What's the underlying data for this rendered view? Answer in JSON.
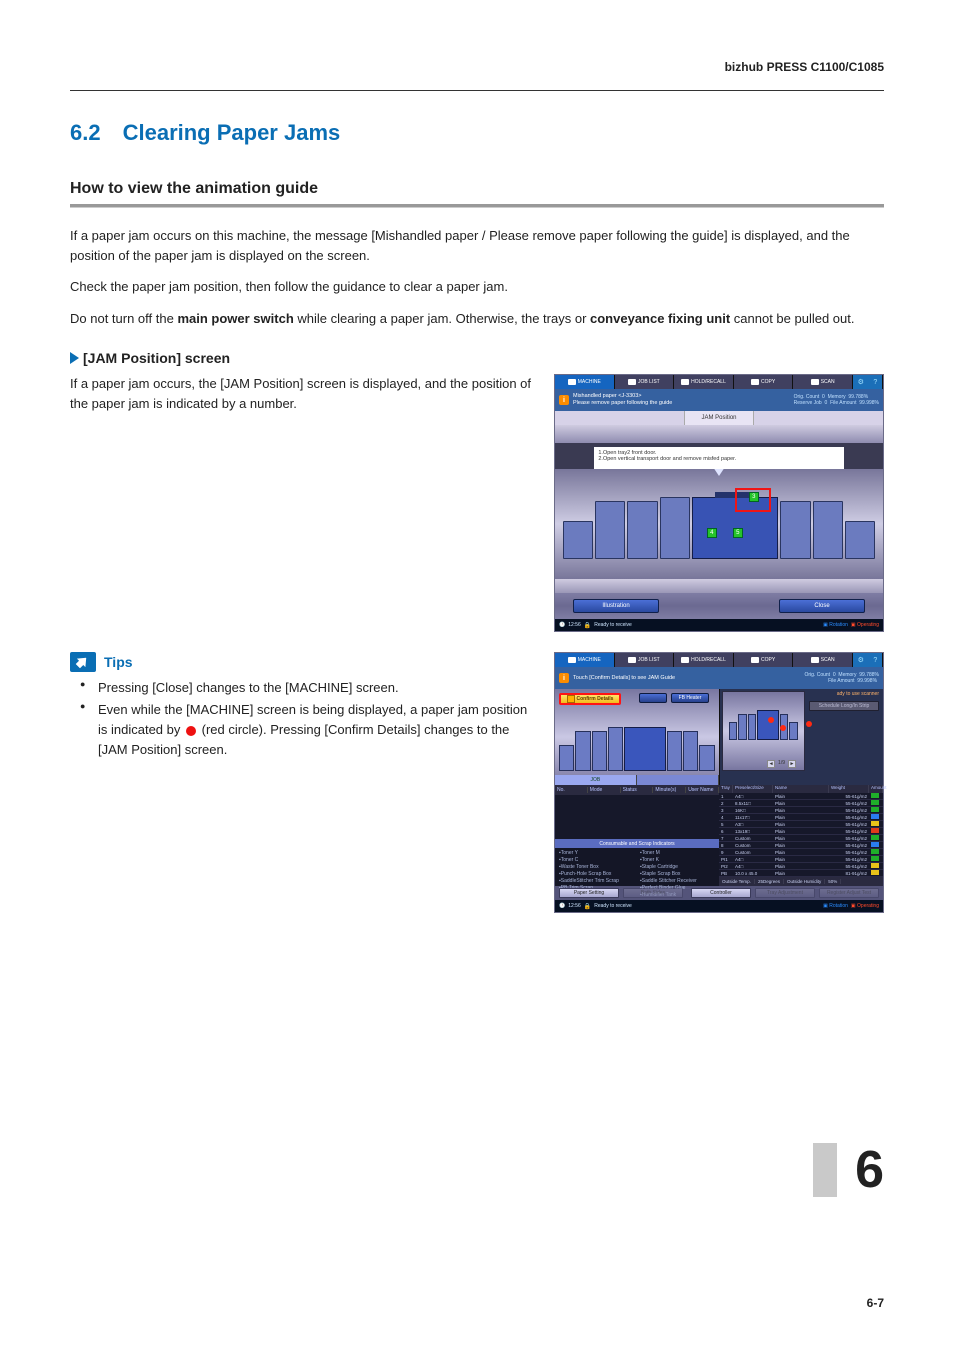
{
  "header": {
    "model": "bizhub PRESS C1100/C1085"
  },
  "section": {
    "number": "6.2",
    "title": "Clearing Paper Jams"
  },
  "subheading1": "How to view the animation guide",
  "intro_paras": {
    "p1": "If a paper jam occurs on this machine, the message [Mishandled paper / Please remove paper following the guide] is displayed, and the position of the paper jam is displayed on the screen.",
    "p2": "Check the paper jam position, then follow the guidance to clear a paper jam.",
    "p3_a": "Do not turn off the ",
    "p3_b": "main power switch",
    "p3_c": " while clearing a paper jam. Otherwise, the trays or ",
    "p3_d": "conveyance fixing unit",
    "p3_e": " cannot be pulled out."
  },
  "h3": "[JAM Position] screen",
  "jam_para": "If a paper jam occurs, the [JAM Position] screen is displayed, and the position of the paper jam is indicated by a number.",
  "tips_label": "Tips",
  "tips": {
    "t1": "Pressing [Close] changes to the [MACHINE] screen.",
    "t2_a": "Even while the [MACHINE] screen is being displayed, a paper jam position is indicated by ",
    "t2_b": " (red circle). Pressing [Confirm Details] changes to the [JAM Position] screen."
  },
  "screenshot1": {
    "tabs": {
      "machine": "MACHINE",
      "joblist": "JOB LIST",
      "recall": "HOLD/RECALL",
      "copy": "COPY",
      "scan": "SCAN"
    },
    "msg": {
      "l1": "Mishandled paper  <J-3303>",
      "l2": "Please remove paper following the guide"
    },
    "counters": {
      "orig": "Orig. Count",
      "orig_v": "0",
      "mem": "Memory",
      "mem_v": "99.788%",
      "res": "Reserve Job",
      "res_v": "0",
      "file": "File Amount",
      "file_v": "99.998%"
    },
    "jam_label": "JAM Position",
    "instructions": {
      "l1": "1.Open tray2 front door.",
      "l2": "2.Open vertical transport door and remove misfed paper."
    },
    "jam_numbers": {
      "a": "3",
      "b": "4",
      "c": "5"
    },
    "buttons": {
      "illust": "Illustration",
      "close": "Close"
    },
    "status": {
      "time": "12:56",
      "ready": "Ready to receive",
      "rot": "Rotation",
      "oper": "Operating"
    }
  },
  "screenshot2": {
    "msg": "Touch [Confirm Details] to see JAM Guide",
    "confirm": "Confirm Details",
    "heater_btn": "FB Heater",
    "ready_scanner": "ady to use scanner",
    "sched_btn": "Schedule Long/In Strip",
    "job_tab": "JOB",
    "job_headers": {
      "no": "No.",
      "mode": "Mode",
      "status": "Status",
      "min": "Minute(s)",
      "user": "User Name"
    },
    "consumable_title": "Consumable and Scrap Indicators",
    "consumables": {
      "left": [
        "Toner Y",
        "Toner C",
        "Waste Toner Box",
        "Punch-Hole Scrap Box",
        "SaddleStitcher Trim Scrap",
        "PB Trim Scrap"
      ],
      "right": [
        "Toner M",
        "Toner K",
        "Staple Cartridge",
        "Staple Scrap Box",
        "Saddle Stitcher Receiver",
        "Perfect Binder Glue",
        "Humidifier Tank"
      ]
    },
    "tray_headers": {
      "tray": "Tray",
      "size": "Preselect/Size",
      "name": "Name",
      "weight": "Weight",
      "amount": "Amount"
    },
    "trays": [
      {
        "n": "1",
        "size": "A4□",
        "name": "Plain",
        "wt": "55-61g/m2",
        "amt": "g"
      },
      {
        "n": "2",
        "size": "8.5x11□",
        "name": "Plain",
        "wt": "55-61g/m2",
        "amt": "g"
      },
      {
        "n": "3",
        "size": "16K□",
        "name": "Plain",
        "wt": "55-61g/m2",
        "amt": "g"
      },
      {
        "n": "4",
        "size": "11x17□",
        "name": "Plain",
        "wt": "55-61g/m2",
        "amt": "b"
      },
      {
        "n": "5",
        "size": "A3□",
        "name": "Plain",
        "wt": "55-61g/m2",
        "amt": "y"
      },
      {
        "n": "6",
        "size": "13x19□",
        "name": "Plain",
        "wt": "55-61g/m2",
        "amt": "r"
      },
      {
        "n": "7",
        "size": "Custom",
        "name": "Plain",
        "wt": "55-61g/m2",
        "amt": "g"
      },
      {
        "n": "8",
        "size": "Custom",
        "name": "Plain",
        "wt": "55-61g/m2",
        "amt": "b"
      },
      {
        "n": "9",
        "size": "Custom",
        "name": "Plain",
        "wt": "55-61g/m2",
        "amt": "g"
      },
      {
        "n": "PI1",
        "size": "A4□",
        "name": "Plain",
        "wt": "55-61g/m2",
        "amt": "g"
      },
      {
        "n": "PI2",
        "size": "A4□",
        "name": "Plain",
        "wt": "55-61g/m2",
        "amt": "y"
      },
      {
        "n": "PB",
        "size": "10.0 x 45.0",
        "name": "Plain",
        "wt": "81-91g/m2",
        "amt": "y"
      }
    ],
    "env": {
      "ot": "Outside Temp.",
      "ot_v": "25Degrees",
      "oh": "Outside Humidity",
      "oh_v": "50%"
    },
    "bottom_tabs": {
      "paper": "Paper Setting",
      "both": "Both Sides",
      "ctrl": "Controller",
      "adj": "Tray Adjustment",
      "reg": "Register Adjust Test"
    },
    "pager": "1/9"
  },
  "chapter_marker": "6",
  "page_number": "6-7"
}
